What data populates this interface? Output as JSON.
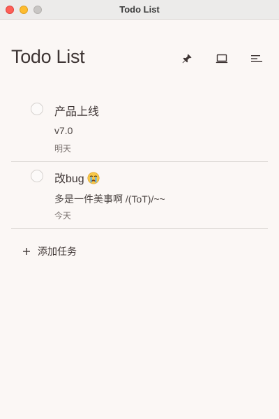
{
  "window": {
    "title": "Todo List"
  },
  "header": {
    "title": "Todo List",
    "actions": [
      {
        "icon": "pin-icon"
      },
      {
        "icon": "laptop-icon"
      },
      {
        "icon": "sort-icon"
      }
    ]
  },
  "todos": [
    {
      "title": "产品上线",
      "note": "v7.0",
      "date": "明天",
      "completed": false
    },
    {
      "title": "改bug",
      "emoji": "crying-face-icon",
      "note": "多是一件美事啊 /(ToT)/~~",
      "date": "今天",
      "completed": false
    }
  ],
  "add_task": {
    "label": "添加任务"
  },
  "colors": {
    "background": "#fbf7f5",
    "text": "#3e3534",
    "divider": "#dad6d3",
    "traffic_close": "#fe5f57",
    "traffic_minimize": "#febc2e",
    "traffic_maximize": "#c8c6c4"
  }
}
